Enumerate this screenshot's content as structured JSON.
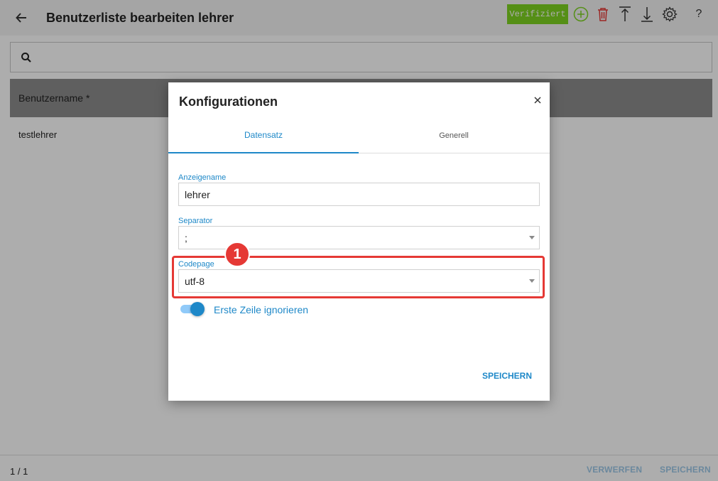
{
  "header": {
    "title": "Benutzerliste bearbeiten lehrer",
    "verified_label": "Verifiziert",
    "help_label": "?"
  },
  "icons": {
    "back": "arrow-left-icon",
    "add": "plus-circle-icon",
    "delete": "trash-icon",
    "upload": "upload-icon",
    "download": "download-icon",
    "settings": "gear-icon",
    "search": "search-icon",
    "close": "close-icon"
  },
  "colors": {
    "verified_bg": "#7ed321",
    "accent": "#1e88c8",
    "delete": "#e53935",
    "highlight": "#e53935"
  },
  "search": {
    "placeholder": ""
  },
  "table": {
    "columns": [
      "Benutzername *"
    ],
    "rows": [
      [
        "testlehrer"
      ]
    ]
  },
  "footer": {
    "pager": "1 / 1",
    "discard_label": "VERWERFEN",
    "save_label": "SPEICHERN"
  },
  "dialog": {
    "title": "Konfigurationen",
    "close_label": "×",
    "tabs": [
      "Datensatz",
      "Generell"
    ],
    "active_tab": 0,
    "fields": {
      "display_name": {
        "label": "Anzeigename",
        "value": "lehrer"
      },
      "separator": {
        "label": "Separator",
        "value": ";"
      },
      "codepage": {
        "label": "Codepage",
        "value": "utf-8"
      }
    },
    "toggle": {
      "label": "Erste Zeile ignorieren",
      "checked": true
    },
    "save_label": "SPEICHERN",
    "step_marker": "1"
  }
}
